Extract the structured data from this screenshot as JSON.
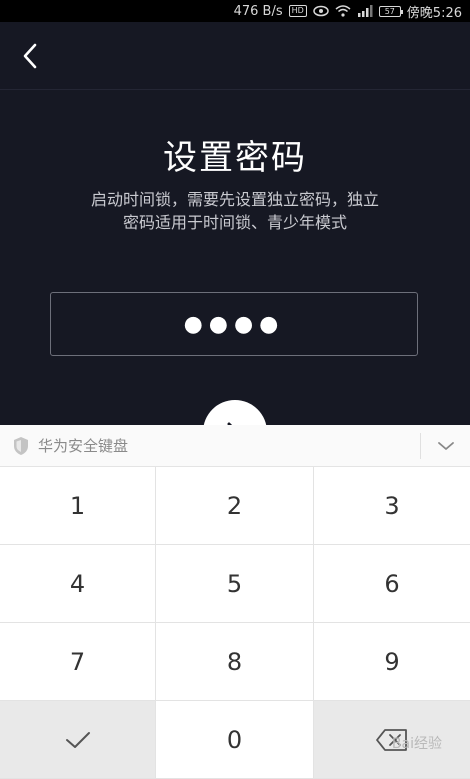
{
  "status_bar": {
    "speed": "476 B/s",
    "hd": "HD",
    "battery": "57",
    "time": "傍晚5:26"
  },
  "header": {
    "back": "back"
  },
  "main": {
    "title": "设置密码",
    "description_line1": "启动时间锁，需要先设置独立密码，独立",
    "description_line2": "密码适用于时间锁、青少年模式",
    "password_mask": "●●●●"
  },
  "keyboard": {
    "title": "华为安全键盘",
    "keys": [
      "1",
      "2",
      "3",
      "4",
      "5",
      "6",
      "7",
      "8",
      "9"
    ],
    "zero": "0"
  },
  "watermark": "Bai经验",
  "colors": {
    "bg": "#161823",
    "keyboard_bg": "#f7f7f7",
    "key_text": "#333333"
  }
}
